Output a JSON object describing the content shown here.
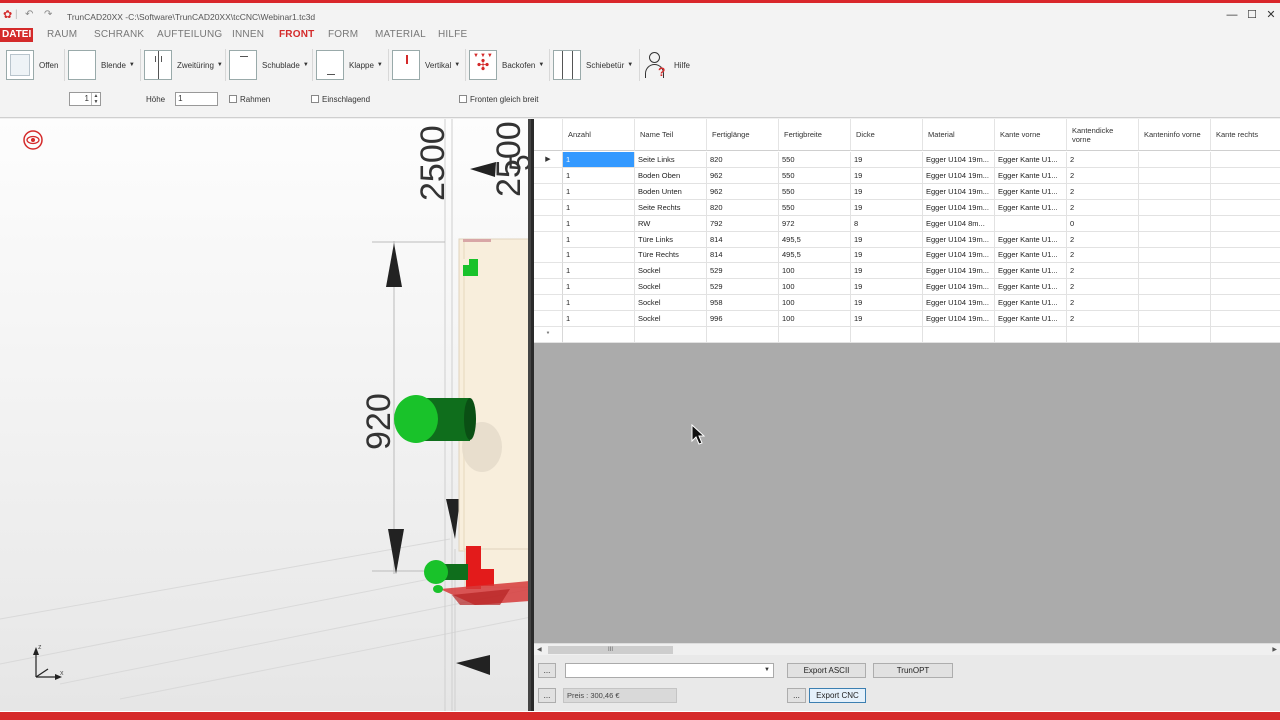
{
  "window": {
    "title": "TrunCAD20XX -C:\\Software\\TrunCAD20XX\\tcCNC\\Webinar1.tc3d",
    "minimize": "—",
    "maximize": "☐",
    "close": "✕"
  },
  "menu": {
    "items": [
      {
        "label": "DATEI",
        "active": false
      },
      {
        "label": "RAUM",
        "active": false
      },
      {
        "label": "SCHRANK",
        "active": false
      },
      {
        "label": "AUFTEILUNG",
        "active": false
      },
      {
        "label": "INNEN",
        "active": false
      },
      {
        "label": "FRONT",
        "active": true
      },
      {
        "label": "FORM",
        "active": false
      },
      {
        "label": "MATERIAL",
        "active": false
      },
      {
        "label": "HILFE",
        "active": false
      }
    ]
  },
  "ribbon": {
    "buttons": [
      {
        "label": "Offen"
      },
      {
        "label": "Blende"
      },
      {
        "label": "Zweitüring"
      },
      {
        "label": "Schublade"
      },
      {
        "label": "Klappe"
      },
      {
        "label": "Vertikal"
      },
      {
        "label": "Backofen"
      },
      {
        "label": "Schiebetür"
      },
      {
        "label": "Hilfe"
      }
    ],
    "spin_value": "1",
    "height_label": "Höhe",
    "height_value": "1",
    "rahmen_label": "Rahmen",
    "einschlagend_label": "Einschlagend",
    "fronten_label": "Fronten gleich breit"
  },
  "viewport": {
    "dim_2500_a": "2500",
    "dim_2500_b": "2500",
    "dim_5": "5",
    "dim_920": "920",
    "axis_z": "z",
    "axis_x": "x"
  },
  "grid": {
    "columns": [
      "Anzahl",
      "Name Teil",
      "Fertiglänge",
      "Fertigbreite",
      "Dicke",
      "Material",
      "Kante vorne",
      "Kantendicke vorne",
      "Kanteninfo vorne",
      "Kante rechts"
    ],
    "rows": [
      [
        "1",
        "Seite Links",
        "820",
        "550",
        "19",
        "Egger U104 19m...",
        "Egger Kante U1...",
        "2",
        "",
        ""
      ],
      [
        "1",
        "Boden Oben",
        "962",
        "550",
        "19",
        "Egger U104 19m...",
        "Egger Kante U1...",
        "2",
        "",
        ""
      ],
      [
        "1",
        "Boden Unten",
        "962",
        "550",
        "19",
        "Egger U104 19m...",
        "Egger Kante U1...",
        "2",
        "",
        ""
      ],
      [
        "1",
        "Seite Rechts",
        "820",
        "550",
        "19",
        "Egger U104 19m...",
        "Egger Kante U1...",
        "2",
        "",
        ""
      ],
      [
        "1",
        "RW",
        "792",
        "972",
        "8",
        "Egger U104 8m...",
        "",
        "0",
        "",
        ""
      ],
      [
        "1",
        "Türe Links",
        "814",
        "495,5",
        "19",
        "Egger U104 19m...",
        "Egger Kante U1...",
        "2",
        "",
        ""
      ],
      [
        "1",
        "Türe Rechts",
        "814",
        "495,5",
        "19",
        "Egger U104 19m...",
        "Egger Kante U1...",
        "2",
        "",
        ""
      ],
      [
        "1",
        "Sockel",
        "529",
        "100",
        "19",
        "Egger U104 19m...",
        "Egger Kante U1...",
        "2",
        "",
        ""
      ],
      [
        "1",
        "Sockel",
        "529",
        "100",
        "19",
        "Egger U104 19m...",
        "Egger Kante U1...",
        "2",
        "",
        ""
      ],
      [
        "1",
        "Sockel",
        "958",
        "100",
        "19",
        "Egger U104 19m...",
        "Egger Kante U1...",
        "2",
        "",
        ""
      ],
      [
        "1",
        "Sockel",
        "996",
        "100",
        "19",
        "Egger U104 19m...",
        "Egger Kante U1...",
        "2",
        "",
        ""
      ]
    ],
    "current_row_marker": "▶",
    "new_row_marker": "*"
  },
  "bottom": {
    "more_btn_1": "...",
    "more_btn_2": "...",
    "more_btn_3": "...",
    "export_ascii": "Export ASCII",
    "trunopt": "TrunOPT",
    "export_cnc": "Export CNC",
    "price": "Preis : 300,46 €",
    "combo_value": ""
  },
  "scroll": {
    "thumb_grip": "III"
  },
  "colors": {
    "accent_red": "#d42a2a",
    "selection_blue": "#3399ff",
    "green_handle": "#19c22a"
  }
}
